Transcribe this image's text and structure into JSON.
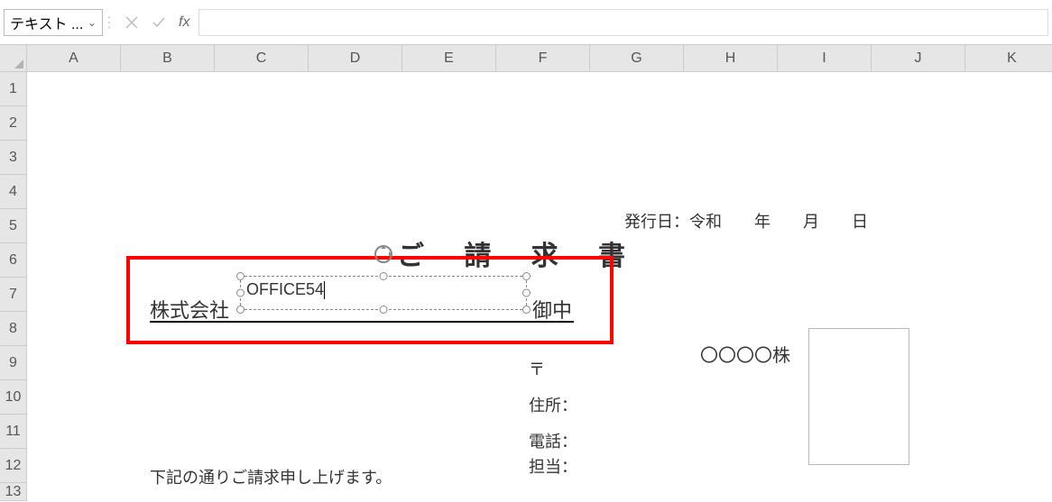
{
  "formula_bar": {
    "name_box_value": "テキスト ...",
    "formula_value": ""
  },
  "columns": [
    "A",
    "B",
    "C",
    "D",
    "E",
    "F",
    "G",
    "H",
    "I",
    "J",
    "K"
  ],
  "rows": [
    "1",
    "2",
    "3",
    "4",
    "5",
    "6",
    "7",
    "8",
    "9",
    "10",
    "11",
    "12",
    "13"
  ],
  "doc": {
    "title": "ご 請 求 書",
    "issue_date_label": "発行日：令和　　年　　月　　日",
    "company_prefix": "株式会社",
    "company_name": "OFFICE54",
    "suffix": "御中",
    "postal": "〒",
    "address": "住所：",
    "phone": "電話：",
    "person": "担当：",
    "your_company": "〇〇〇〇株",
    "footer": "下記の通りご請求申し上げます。"
  }
}
